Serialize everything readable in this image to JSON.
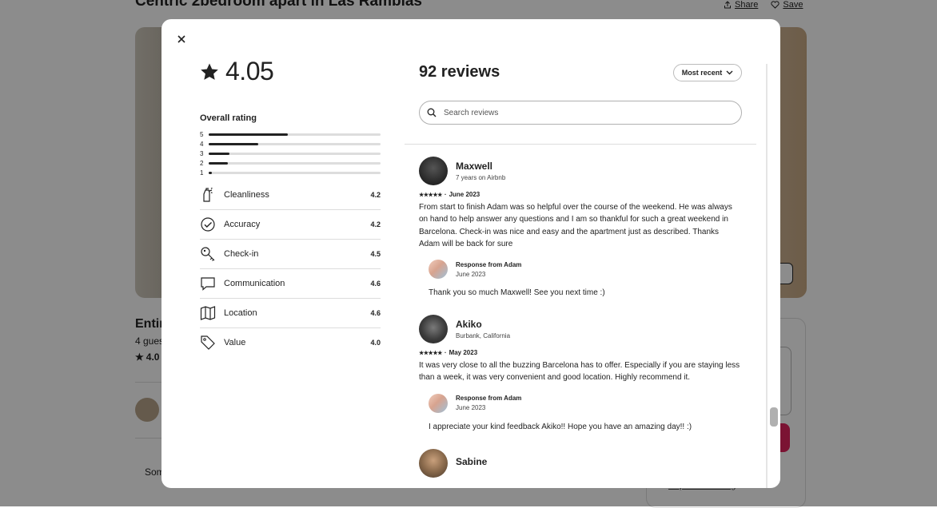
{
  "background": {
    "title": "Centric 2bedroom apart in Las Ramblas",
    "share_label": "Share",
    "save_label": "Save",
    "entire_label": "Entir",
    "guests_label": "4 gues",
    "rating_label": "4.0",
    "some_label": "Som",
    "report_label": "Report this listing"
  },
  "modal": {
    "rating": "4.05",
    "overall_label": "Overall rating",
    "histogram": [
      {
        "label": "5",
        "fraction": 0.46
      },
      {
        "label": "4",
        "fraction": 0.29
      },
      {
        "label": "3",
        "fraction": 0.12
      },
      {
        "label": "2",
        "fraction": 0.11
      },
      {
        "label": "1",
        "fraction": 0.02
      }
    ],
    "categories": [
      {
        "label": "Cleanliness",
        "score": "4.2",
        "icon": "spray-bottle-icon"
      },
      {
        "label": "Accuracy",
        "score": "4.2",
        "icon": "check-circle-icon"
      },
      {
        "label": "Check-in",
        "score": "4.5",
        "icon": "key-icon"
      },
      {
        "label": "Communication",
        "score": "4.6",
        "icon": "chat-bubble-icon"
      },
      {
        "label": "Location",
        "score": "4.6",
        "icon": "map-icon"
      },
      {
        "label": "Value",
        "score": "4.0",
        "icon": "tag-icon"
      }
    ],
    "reviews_count": "92 reviews",
    "sort_label": "Most recent",
    "search_placeholder": "Search reviews",
    "reviews": [
      {
        "name": "Maxwell",
        "subtitle": "7 years on Airbnb",
        "stars": "★★★★★",
        "sep": "·",
        "date": "June 2023",
        "text": "From start to finish Adam was so helpful over the course of the weekend. He was always on hand to help answer any questions and I am so thankful for such a great weekend in Barcelona. Check-in was nice and easy and the apartment just as described. Thanks Adam will be back for sure",
        "response_title": "Response from Adam",
        "response_date": "June 2023",
        "response_text": "Thank you so much Maxwell! See you next time :)"
      },
      {
        "name": "Akiko",
        "subtitle": "Burbank, California",
        "stars": "★★★★★",
        "sep": "·",
        "date": "May 2023",
        "text": "It was very close to all the buzzing Barcelona has to offer. Especially if you are staying less than a week, it was very convenient and good location. Highly recommend it.",
        "response_title": "Response from Adam",
        "response_date": "June 2023",
        "response_text": "I appreciate your kind feedback Akiko!! Hope you have an amazing day!! :)"
      },
      {
        "name": "Sabine",
        "subtitle": ""
      }
    ]
  }
}
